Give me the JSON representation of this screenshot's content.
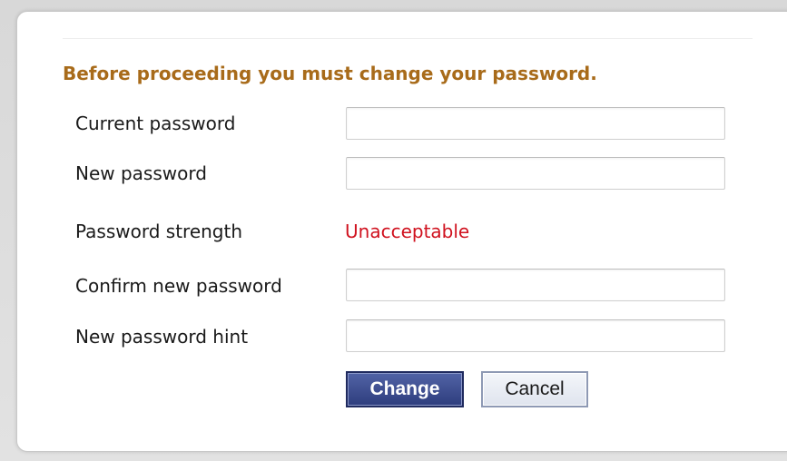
{
  "dialog": {
    "heading": "Before proceeding you must change your password.",
    "fields": [
      {
        "label": "Current password",
        "value": "",
        "placeholder": ""
      },
      {
        "label": "New password",
        "value": "",
        "placeholder": ""
      },
      {
        "label": "Confirm new password",
        "value": "",
        "placeholder": ""
      },
      {
        "label": "New password hint",
        "value": "",
        "placeholder": ""
      }
    ],
    "strength": {
      "label": "Password strength",
      "value": "Unacceptable",
      "color": "#d0121f"
    },
    "buttons": {
      "change_label": "Change",
      "cancel_label": "Cancel"
    }
  },
  "colors": {
    "heading": "#a86b1a",
    "primary_button": "#2e3d7d"
  }
}
